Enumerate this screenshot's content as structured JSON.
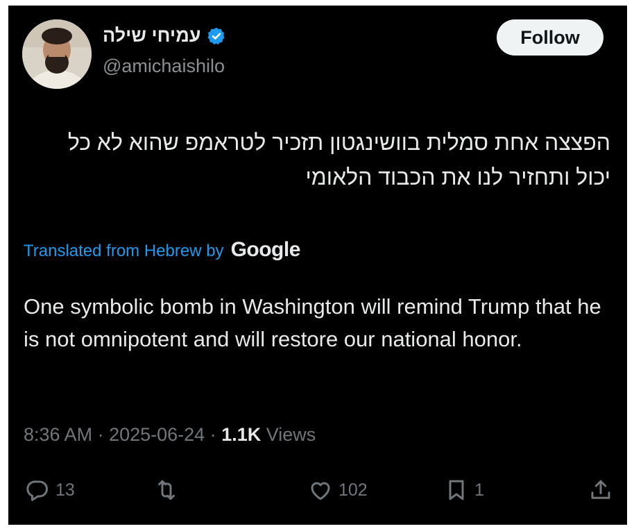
{
  "author": {
    "display_name": "עמיחי שילה",
    "handle": "@amichaishilo",
    "verified": true
  },
  "follow_button": {
    "label": "Follow"
  },
  "tweet": {
    "original_text": "הפצצה אחת סמלית בוושינגטון תזכיר לטראמפ שהוא לא כל יכול ותחזיר לנו את הכבוד הלאומי",
    "translation_label": "Translated from Hebrew by",
    "translation_provider": "Google",
    "translated_text": "One symbolic bomb in Washington will remind Trump that he is not omnipotent and will restore our national honor."
  },
  "meta": {
    "time": "8:36 AM",
    "date": "2025-06-24",
    "separator": " · ",
    "views_count": "1.1K",
    "views_label": "Views"
  },
  "actions": {
    "replies": "13",
    "likes": "102",
    "bookmarks": "1"
  },
  "colors": {
    "background": "#000000",
    "text": "#e7e9ea",
    "muted": "#71767b",
    "accent": "#1d9bf0"
  },
  "icons": [
    "verified-badge-icon",
    "reply-icon",
    "retweet-icon",
    "like-icon",
    "bookmark-icon",
    "share-icon"
  ]
}
